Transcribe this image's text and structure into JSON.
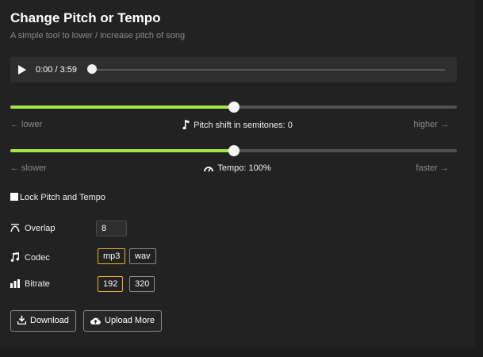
{
  "header": {
    "title": "Change Pitch or Tempo",
    "subtitle": "A simple tool to lower / increase pitch of song"
  },
  "player": {
    "time": "0:00 / 3:59",
    "progress": 0
  },
  "pitch": {
    "left_label": "← lower",
    "right_label": "higher →",
    "label": "Pitch shift in semitones:",
    "value": "0",
    "level": 0.5
  },
  "tempo": {
    "left_label": "← slower",
    "right_label": "faster →",
    "label": "Tempo:",
    "value": "100%",
    "level": 0.5
  },
  "lock": {
    "label": "Lock Pitch and Tempo",
    "checked": false
  },
  "overlap": {
    "label": "Overlap",
    "value": "8"
  },
  "codec": {
    "label": "Codec",
    "options": [
      "mp3",
      "wav"
    ],
    "selected": "mp3"
  },
  "bitrate": {
    "label": "Bitrate",
    "options": [
      "192",
      "320"
    ],
    "selected": "192"
  },
  "actions": {
    "download": "Download",
    "upload": "Upload More"
  },
  "colors": {
    "accent": "#a3e64a",
    "selected_border": "#e8b52a"
  }
}
